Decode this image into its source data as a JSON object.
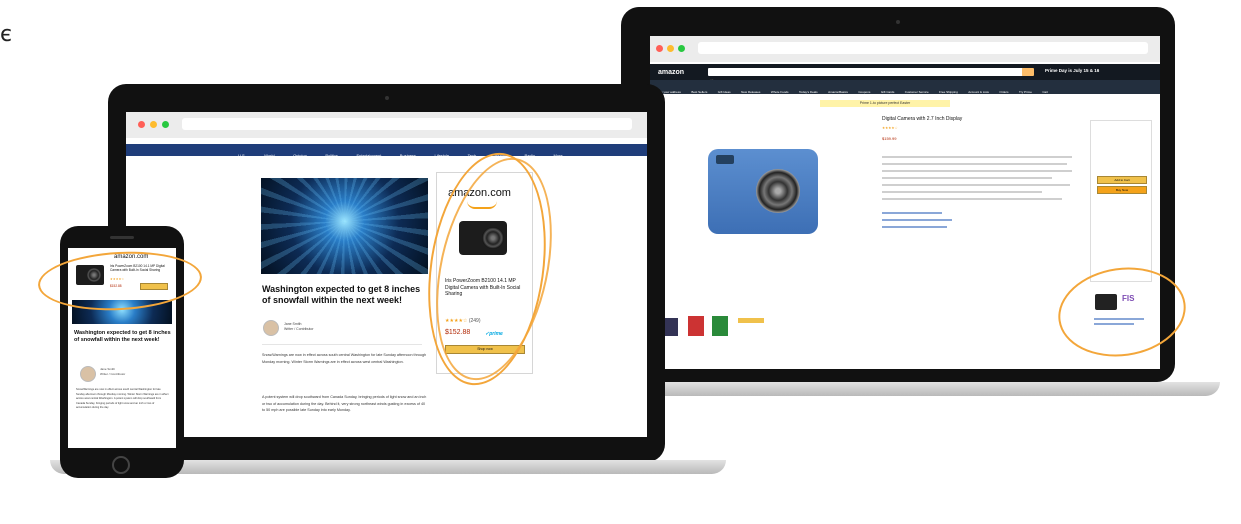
{
  "corner_glyph": "є",
  "news_site": {
    "nav": [
      "U.S.",
      "World",
      "Opinion",
      "Politics",
      "Entertainment",
      "Business",
      "Lifestyle",
      "Tech",
      "Health",
      "Radio",
      "More"
    ],
    "headline": "Washington expected to get 8 inches of snowfall within the next week!",
    "author": "Jane Smith",
    "author_role": "Writer / Contributor",
    "body": [
      "Snow/Warnings are now in effect across south central Washington for late Sunday afternoon through Monday morning. Winter Storm Warnings are in effect across west central Washington.",
      "A potent system will drop southward from Canada Sunday, bringing periods of light snow and an inch or two of accumulation during the day. Behind it, very strong northeast winds gusting in excess of 40 to 50 mph are possible late Sunday into early Monday."
    ]
  },
  "amazon_ad": {
    "logo": "amazon.com",
    "product_title": "Iris PowerZoom B2100 14.1 MP Digital Camera with Built-In Social Sharing",
    "stars": "★★★★☆",
    "reviews": "(249)",
    "price": "$152.88",
    "prime": "✓prime",
    "button": "Shop now"
  },
  "amazon_page": {
    "logo": "amazon",
    "search_hint": "All",
    "prime_day": "Prime Day is July 15 & 16",
    "subnav": [
      "Deliver to your address",
      "Best Sellers",
      "Gift Ideas",
      "New Releases",
      "Whole Foods",
      "Today's Deals",
      "AmazonBasics",
      "Coupons",
      "Gift Cards",
      "Customer Service",
      "Free Shipping",
      "Account & Lists",
      "Orders",
      "Try Prime",
      "Cart"
    ],
    "banner": "Prime 1-to picture perfect Easter",
    "product_title": "Digital Camera with 2.7 Inch Display",
    "stars": "★★★★☆",
    "price": "$159.99",
    "add_to_cart": "Add to Cart",
    "buy_now": "Buy Now",
    "side_ad_brand": "FIS"
  },
  "phone": {
    "ad_logo": "amazon.com",
    "ad_title": "Iris PowerZoom B2100 14.1 MP Digital Camera with Built-In Social Sharing",
    "ad_stars": "★★★★☆",
    "ad_price": "$152.88",
    "headline": "Washington expected to get 8 inches of snowfall within the next week!",
    "author": "Jane Smith",
    "author_role": "Writer / Contributor",
    "body": "Snow/Warnings are now in effect across south central Washington for late Sunday afternoon through Monday morning. Winter Storm Warnings are in effect across west central Washington. A potent system will drop southward from Canada Sunday, bringing periods of light snow and an inch or two of accumulation during the day."
  },
  "colors": {
    "highlight": "#f3a63a",
    "nav_blue": "#1f3d7a",
    "amazon_dark": "#131921",
    "amazon_orange": "#febd69",
    "price_red": "#b12704"
  }
}
